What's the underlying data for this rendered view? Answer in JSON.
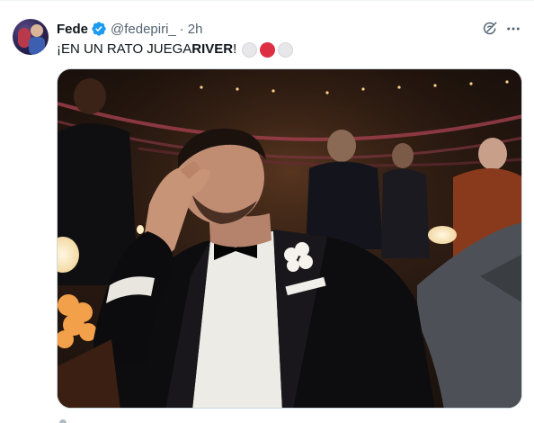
{
  "author": {
    "display_name": "Fede",
    "handle": "@fedepiri_",
    "separator": "·",
    "time": "2h",
    "verified": true
  },
  "tweet": {
    "text_prefix": "¡EN UN RATO JUEGA ",
    "text_bold": "RIVER",
    "text_suffix": "!",
    "emoji_circles": [
      "white",
      "red",
      "white"
    ]
  },
  "media": {
    "kind": "image",
    "description_icon": "photo"
  },
  "colors": {
    "text": "#0f1419",
    "secondary": "#536471",
    "verified_blue": "#1d9bf0",
    "river_red": "#dd2e44",
    "border": "#cfd9de"
  },
  "icons": [
    "grok-icon",
    "more-icon",
    "verified-badge-icon"
  ]
}
